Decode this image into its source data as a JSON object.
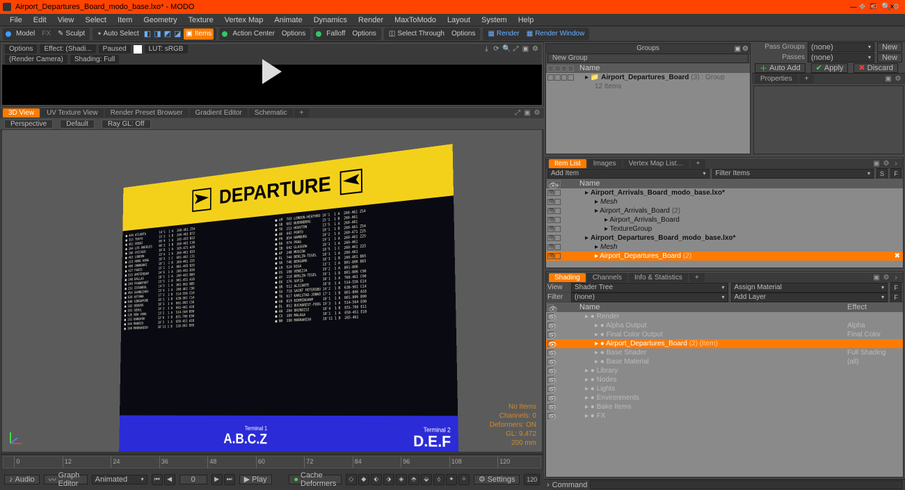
{
  "window": {
    "title": "Airport_Departures_Board_modo_base.lxo* - MODO"
  },
  "menu": [
    "File",
    "Edit",
    "View",
    "Select",
    "Item",
    "Geometry",
    "Texture",
    "Vertex Map",
    "Animate",
    "Dynamics",
    "Render",
    "MaxToModo",
    "Layout",
    "System",
    "Help"
  ],
  "toolbar": {
    "model": "Model",
    "sculpt": "Sculpt",
    "autoselect": "Auto Select",
    "items": "Items",
    "actioncenter": "Action Center",
    "options1": "Options",
    "falloff": "Falloff",
    "options2": "Options",
    "selectthrough": "Select Through",
    "options3": "Options",
    "render": "Render",
    "renderwindow": "Render Window"
  },
  "preview": {
    "options": "Options",
    "effect": "Effect: (Shadi...",
    "paused": "Paused",
    "lut": "LUT: sRGB",
    "camera": "(Render Camera)",
    "shading": "Shading: Full"
  },
  "tabs3d": [
    "3D View",
    "UV Texture View",
    "Render Preset Browser",
    "Gradient Editor",
    "Schematic"
  ],
  "viewportHead": {
    "perspective": "Perspective",
    "default": "Default",
    "raygl": "Ray GL: Off"
  },
  "board": {
    "title": "DEPARTURE",
    "terminal1_lbl": "Terminal 1",
    "terminal1_gates": "A.B.C.Z",
    "terminal2_lbl": "Terminal 2",
    "terminal2_gates": "D.E.F",
    "rows": "■ 444 ATLANTA        14'1  1 A  260-461 Z54\n■ 315 TOKYO          15'2  1 B  260-461 B72\n■ 452 DUBAI          09'4  1 A  165-453 B22\n■ 264 LOS ANGELES    08'3  1 B  260-461 C30\n■ 186 CHICAGO        16'8  1 A  165-471 A30\n■ 463 LONDON         13'4  1 A  260-461 B19\n■ 223 HONG KONG      18'3  1 C  601-461 C31\n■ 408 SHANGHAI       18'1  1 B  260-461 Z25\n■ 427 PARIS          15'1  1 A  801-403 B39\n■ 515 AMSTERDAM      14'6  1 A  260-461 B38\n■ 148 DALLAS         18'1  1 A  260-461 B80\n■ 240 FRANKFURT      13'5  1 B  001-451 A18\n■ 232 ISTANBUL       14'3  1 A  801-902 B85\n■ 454 GUANGZHOU      15'4  1 A  260-461 C90\n■ 620 ASTANA         17'2  1 B  514-556 E14\n■ 640 SINGAPORE      16'1  1 B  638-901 C14\n■ 182 DENVER         18'1  1 A  861-003 C56\n■ 191 SEOUL          14'3  1 A  061-461 A18\n■ 126 NEW YORK       13'2  1 A  514-564 B90\n■ 152 BANGKOK        12'6  1 B  831-706 E90\n■ 344 MADRID         18'2  1 A  658-451 A18\n■ 198 MARRAKESH      18'11 1 B  118-061 D09",
    "rows2": "■ LM  703 LONDON-HEATHRO 16'1  1 A  260-461 Z54\n■ SB  602 NUERNBERG      15'1  1 B  260-461\n■ TR  212 HOUSTON        13'5  1 A  260-461\n■ AK  442 PORTO          18'1  1 B  260-461 Z54\n■ PR  854 HAMBURG        18'2  1 A  260-471 Z25\n■ BA  974 PRAG           19'1  1 A  260-461 Z25\n■ IB  642 GLASGOW        18'1  1 A  260-461\n■ AF  248 MOSCOW         18'5  1 C  260-461 Z25\n■ KL  744 BERLIN-TEGEL   18'1  1 A  260-461\n■ SK  746 BERGAMO        18'3  1 B  260-461 B65\n■ LH  524 RIGA           13'1  1 A  801-806 B65\n■ OS  198 VENEZJA        19'2  1 A  801-806\n■ AY  118 BERLIN-TEGEL   19'1  1 B  801-806 C90\n■ EK  176 SOFIA          18'1  1 A  760-461 C90\n■ QR  512 ALICANTE       18'8  1 A  514-556 E14\n■ SU  718 SAINT PETERSBU 14'2  1 B  638-901 C14\n■ TK  617 KARLSTAD-JONKO 17'1  1 B  801-806 A18\n■ UA  819 BIRMINGHAM     18'1  1 A  801-806 B90\n■ DL  852 BUCHAREST-PODG 19'3  1 A  514-564 E90\n■ AA  284 BRINDISI       18'4  1 B  831-706 E11\n■ CX  189 MALAGA         18'1  1 A  658-451 E10\n■ NH  198 MARRAKESH      18'11 1 B  265-461"
  },
  "vpStatus": {
    "l1": "No Items",
    "l2": "Channels: 0",
    "l3": "Deformers: ON",
    "l4": "GL: 9,472",
    "l5": "200 mm"
  },
  "groupsPanel": {
    "title": "Groups",
    "newgroup": "New Group",
    "namehdr": "Name",
    "row1": "Airport_Departures_Board",
    "row1suffix": "(3) : Group",
    "row2": "12 Items"
  },
  "passRow": {
    "passgroups": "Pass Groups",
    "none1": "(none)",
    "new": "New",
    "passes": "Passes",
    "none2": "(none)",
    "new2": "New"
  },
  "applyRow": {
    "autoadd": "Auto Add",
    "apply": "Apply",
    "discard": "Discard"
  },
  "propTab": "Properties",
  "itemListTabs": [
    "Item List",
    "Images",
    "Vertex Map List…"
  ],
  "itemList": {
    "additem": "Add Item",
    "filter": "Filter Items",
    "namehdr": "Name",
    "rows": [
      {
        "indent": 1,
        "label": "Airport_Arrivals_Board_modo_base.lxo*",
        "bold": true
      },
      {
        "indent": 2,
        "label": "Mesh",
        "italic": true
      },
      {
        "indent": 2,
        "label": "Airport_Arrivals_Board",
        "suffix": "(2)"
      },
      {
        "indent": 3,
        "label": "Airport_Arrivals_Board"
      },
      {
        "indent": 3,
        "label": "TextureGroup"
      },
      {
        "indent": 1,
        "label": "Airport_Departures_Board_modo_base.lxo*",
        "bold": true
      },
      {
        "indent": 2,
        "label": "Mesh",
        "italic": true
      },
      {
        "indent": 2,
        "label": "Airport_Departures_Board",
        "suffix": "(2)",
        "sel": true
      }
    ]
  },
  "shadingTabs": [
    "Shading",
    "Channels",
    "Info & Statistics"
  ],
  "shadingCtl": {
    "view": "View",
    "shadertree": "Shader Tree",
    "assign": "Assign Material",
    "filter": "Filter",
    "none": "(none)",
    "addlayer": "Add Layer",
    "namehdr": "Name",
    "effecthdr": "Effect"
  },
  "shadingRows": [
    {
      "indent": 1,
      "name": "Render",
      "effect": ""
    },
    {
      "indent": 2,
      "name": "Alpha Output",
      "effect": "Alpha"
    },
    {
      "indent": 2,
      "name": "Final Color Output",
      "effect": "Final Color"
    },
    {
      "indent": 2,
      "name": "Airport_Departures_Board",
      "suffix": "(2) (Item)",
      "effect": "",
      "sel": true
    },
    {
      "indent": 2,
      "name": "Base Shader",
      "effect": "Full Shading"
    },
    {
      "indent": 2,
      "name": "Base Material",
      "effect": "(all)"
    },
    {
      "indent": 1,
      "name": "Library",
      "effect": ""
    },
    {
      "indent": 1,
      "name": "Nodes",
      "effect": ""
    },
    {
      "indent": 1,
      "name": "Lights",
      "effect": ""
    },
    {
      "indent": 1,
      "name": "Environments",
      "effect": ""
    },
    {
      "indent": 1,
      "name": "Bake Items",
      "effect": ""
    },
    {
      "indent": 1,
      "name": "FX",
      "effect": ""
    }
  ],
  "timeline": {
    "ticks": [
      "0",
      "12",
      "24",
      "36",
      "48",
      "60",
      "72",
      "84",
      "96",
      "108",
      "120"
    ],
    "audio": "Audio",
    "graph": "Graph Editor",
    "animated": "Animated",
    "frame": "0",
    "play": "Play",
    "cache": "Cache Deformers",
    "settings": "Settings"
  },
  "command": {
    "label": "Command"
  }
}
